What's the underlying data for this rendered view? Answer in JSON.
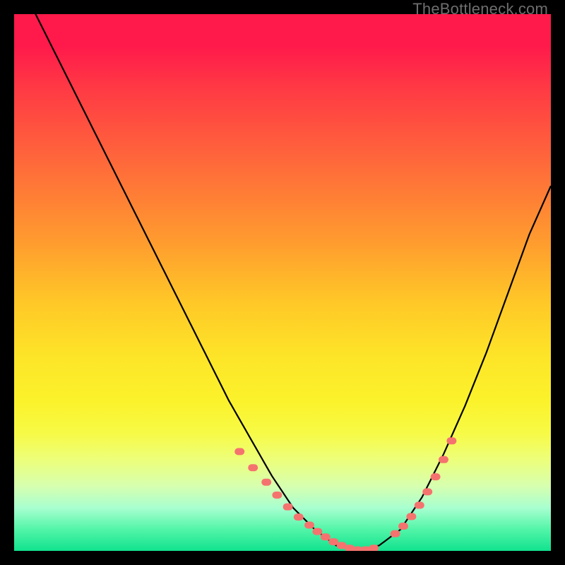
{
  "watermark": "TheBottleneck.com",
  "colors": {
    "page_bg": "#000000",
    "curve": "#000000",
    "marker": "#f5736f",
    "gradient_top": "#ff1a4b",
    "gradient_bottom": "#11e28e"
  },
  "chart_data": {
    "type": "line",
    "title": "",
    "xlabel": "",
    "ylabel": "",
    "xlim": [
      0,
      100
    ],
    "ylim": [
      0,
      100
    ],
    "grid": false,
    "legend": false,
    "series": [
      {
        "name": "bottleneck-curve",
        "x": [
          0,
          4,
          8,
          12,
          16,
          20,
          24,
          28,
          32,
          36,
          40,
          44,
          48,
          52,
          56,
          60,
          64,
          68,
          72,
          76,
          80,
          84,
          88,
          92,
          96,
          100
        ],
        "values": [
          110,
          100,
          92,
          84,
          76,
          68,
          60,
          52,
          44,
          36,
          28,
          21,
          14,
          8,
          4,
          1,
          0,
          1,
          4,
          10,
          18,
          27,
          37,
          48,
          59,
          68
        ]
      }
    ],
    "markers": {
      "name": "highlight-dots",
      "x": [
        42,
        44.5,
        47,
        49,
        51,
        53,
        55,
        56.5,
        58,
        59.5,
        61,
        62.5,
        64,
        65.5,
        67,
        71,
        72.5,
        74,
        75.5,
        77,
        78.5,
        80,
        81.5
      ],
      "values": [
        18.5,
        15.5,
        12.8,
        10.4,
        8.2,
        6.3,
        4.8,
        3.6,
        2.6,
        1.7,
        1.0,
        0.5,
        0.2,
        0.2,
        0.5,
        3.2,
        4.6,
        6.4,
        8.5,
        11.0,
        13.8,
        17.0,
        20.5
      ]
    }
  }
}
